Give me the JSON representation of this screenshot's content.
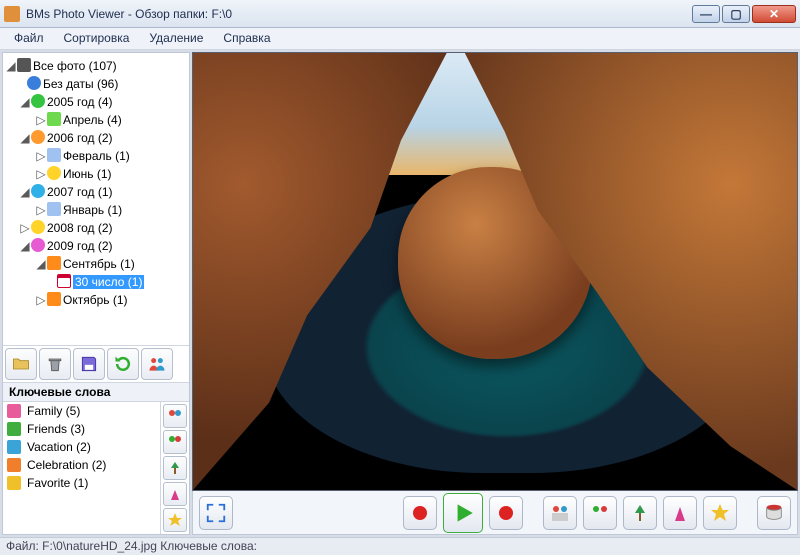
{
  "window": {
    "title": "BMs Photo Viewer - Обзор папки: F:\\0"
  },
  "menu": {
    "file": "Файл",
    "sort": "Сортировка",
    "delete": "Удаление",
    "help": "Справка"
  },
  "tree": {
    "root": "Все фото (107)",
    "nodate": "Без даты (96)",
    "y2005": "2005 год (4)",
    "y2005_apr": "Апрель (4)",
    "y2006": "2006 год (2)",
    "y2006_feb": "Февраль (1)",
    "y2006_jun": "Июнь (1)",
    "y2007": "2007 год (1)",
    "y2007_jan": "Январь (1)",
    "y2008": "2008 год (2)",
    "y2009": "2009 год (2)",
    "y2009_sep": "Сентябрь (1)",
    "y2009_sep_30": "30 число (1)",
    "y2009_oct": "Октябрь (1)"
  },
  "kw": {
    "header": "Ключевые слова",
    "items": [
      {
        "label": "Family (5)"
      },
      {
        "label": "Friends (3)"
      },
      {
        "label": "Vacation (2)"
      },
      {
        "label": "Celebration (2)"
      },
      {
        "label": "Favorite (1)"
      }
    ]
  },
  "status": {
    "text": "Файл: F:\\0\\natureHD_24.jpg Ключевые слова:"
  }
}
